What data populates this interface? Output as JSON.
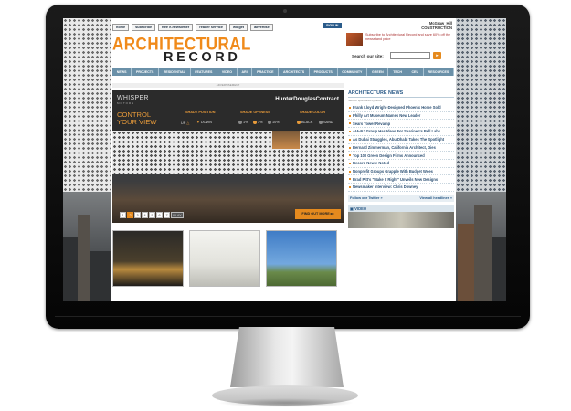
{
  "site": {
    "logo_top": "ARCHITECTURAL",
    "logo_bottom": "RECORD",
    "utility_links": [
      "home",
      "subscribe",
      "free e-newsletter",
      "reader service",
      "widget",
      "advertise"
    ],
    "sign_in": "SIGN IN",
    "publisher": [
      "McGraw_Hill",
      "CONSTRUCTION"
    ],
    "promo_text": "Subscribe to Architectural Record and save 60% off the newsstand price",
    "search_label": "Search our site:",
    "search_placeholder": "",
    "nav": [
      "NEWS",
      "PROJECTS",
      "RESIDENTIAL",
      "FEATURES",
      "VIDEO",
      "ARI",
      "PRACTICE",
      "ARCHITECTS",
      "PRODUCTS",
      "COMMUNITY",
      "GREEN",
      "TECH",
      "CEU",
      "RESOURCES"
    ]
  },
  "ad": {
    "label": "ADVERTISEMENT",
    "brand": "WHISPER",
    "brand_sub": "MOTORS",
    "partner": "HunterDouglasContract",
    "control_line1": "CONTROL",
    "control_line2": "YOUR VIEW",
    "shade_position": "SHADE POSITION",
    "shade_openess": "SHADE OPENESS",
    "shade_color": "SHADE COLOR",
    "up": "UP",
    "down": "DOWN",
    "pct1": "1%",
    "pct3": "3%",
    "pct10": "10%",
    "black": "BLACK",
    "sand": "SAND",
    "pages": [
      "1",
      "2",
      "3",
      "4",
      "5",
      "6",
      "7"
    ],
    "play": "PLAY",
    "find_out": "FIND OUT MORE ▸▸"
  },
  "sidebar": {
    "title": "ARCHITECTURE NEWS",
    "sponsor": "Section sponsored by Alcoa",
    "headlines": [
      "Frank Lloyd Wright-Designed Phoenix Home Sold",
      "Philly Art Museum Names New Leader",
      "Sears Tower Revamp",
      "AIA-NJ Group Has Ideas For Saarinen's Bell Labs",
      "As Dubai Struggles, Abu Dhabi Takes The Spotlight",
      "Bernard Zimmerman, California Architect, Dies",
      "Top 100 Green Design Firms Announced",
      "Record News: Noted",
      "Nonprofit Groups Grapple With Budget Woes",
      "Brad Pitt's \"Make It Right\" Unveils New Designs",
      "Newsmaker Interview: Chris Downey"
    ],
    "follow": "Follow our Twitter »",
    "view_all": "View all headlines »",
    "video_label": "VIDEO"
  }
}
